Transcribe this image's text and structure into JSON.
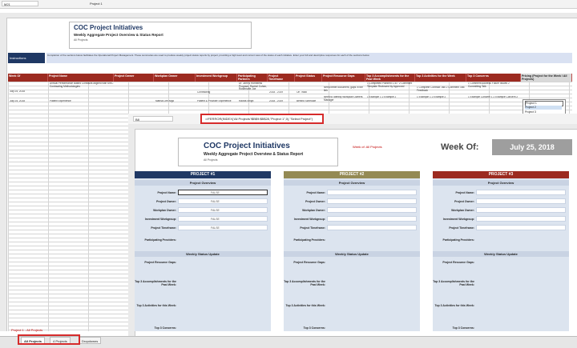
{
  "back": {
    "namebox": "M21",
    "formula": "Project 1",
    "title": "COC Project Initiatives",
    "subtitle": "Weekly Aggregate Project Overview & Status Report",
    "small": "All Projects",
    "instructions_label": "Instructions",
    "instructions_text": "Completion of the sections below facilitates the Operational Project Management. These summaries are used to produce weekly project status reports by project, providing a high level and current view of the status of each initiative. Enter your full and descriptive responses for each of the sections below.",
    "headers": [
      "Week Of",
      "Project Name",
      "Project Owner",
      "Workplan Owner",
      "Investment Workgroup",
      "Participating Partners",
      "Project Timeframe",
      "Project Status",
      "Project Resource Gaps",
      "Top 3 Accomplishments for the Past Week",
      "Top 3 Activities for the Week",
      "Top 3 Concerns",
      "Pricing (Project for the Week / All Projects)"
    ],
    "rows": [
      {
        "week": "July 25, 2018",
        "name": "Annual Performance Based Contracts aligned with MRC Contracting Methodologies",
        "inv": "Contracting",
        "partners": "Dr. John's Homeless Program, Rachel Cohen, Rosemarie Joe",
        "time": "2018 - 2019",
        "status": "On Track",
        "gaps": "Need better document, gaps in the link",
        "acc": "1 Completed Planned 1-4/7 2 Comment Template Reviewed by Approved",
        "act": "1 Complete Contract Talk 2 Comment Talk Feedback",
        "con": "1 Comment Address Future Issues 2 Committing Talk"
      },
      {
        "week": "July 25, 2018",
        "name": "Patient Experience",
        "wp": "Marisa Lee Argo",
        "inv": "Patient & Provider Experience",
        "partners": "Radha Singh",
        "time": "2018 - 2019",
        "status": "Behind Schedule",
        "gaps": "Need to Identify Workplan Owners Manager",
        "acc": "1 Example 1 2 Example 2",
        "act": "1 Example 1 2 Example 2",
        "con": "1 Example Concern 1 2 Example Concern 2"
      }
    ],
    "dropdown": [
      "Project 1",
      "Project 2",
      "Project 3"
    ]
  },
  "front": {
    "namebox": "B8",
    "formula": "=IFERROR(INDEX('All Projects'!$B$9:$B$28,\"Project 1\",0),\"Select Project\")",
    "title": "COC Project Initiatives",
    "subtitle": "Weekly Aggregate Project Overview & Status Report",
    "small": "All Projects",
    "note": "Week of: All Projects",
    "week_label": "Week Of:",
    "week_value": "July 25, 2018",
    "projects": [
      {
        "header": "PROJECT #1",
        "color": "#1f3864",
        "value": "FALSE"
      },
      {
        "header": "PROJECT #2",
        "color": "#948a54",
        "value": ""
      },
      {
        "header": "PROJECT #3",
        "color": "#9c2a20",
        "value": ""
      }
    ],
    "overview_label": "Project Overview",
    "status_label": "Weekly Status Update",
    "fields": [
      "Project Name:",
      "Project Owner:",
      "Workplan Owner:",
      "Investment Workgroup:",
      "Project Timeframe:"
    ],
    "participating": "Participating Providers:",
    "status_fields": [
      "Project Resource Gaps:",
      "Top 3 Accomplishments for the Past Week:",
      "Top 3 Activities for this Week:",
      "Top 3 Concerns:"
    ]
  },
  "tabs": [
    "All Projects",
    "4 Projects",
    "Dropdowns"
  ],
  "side_note": "Project 1 - All Projects"
}
